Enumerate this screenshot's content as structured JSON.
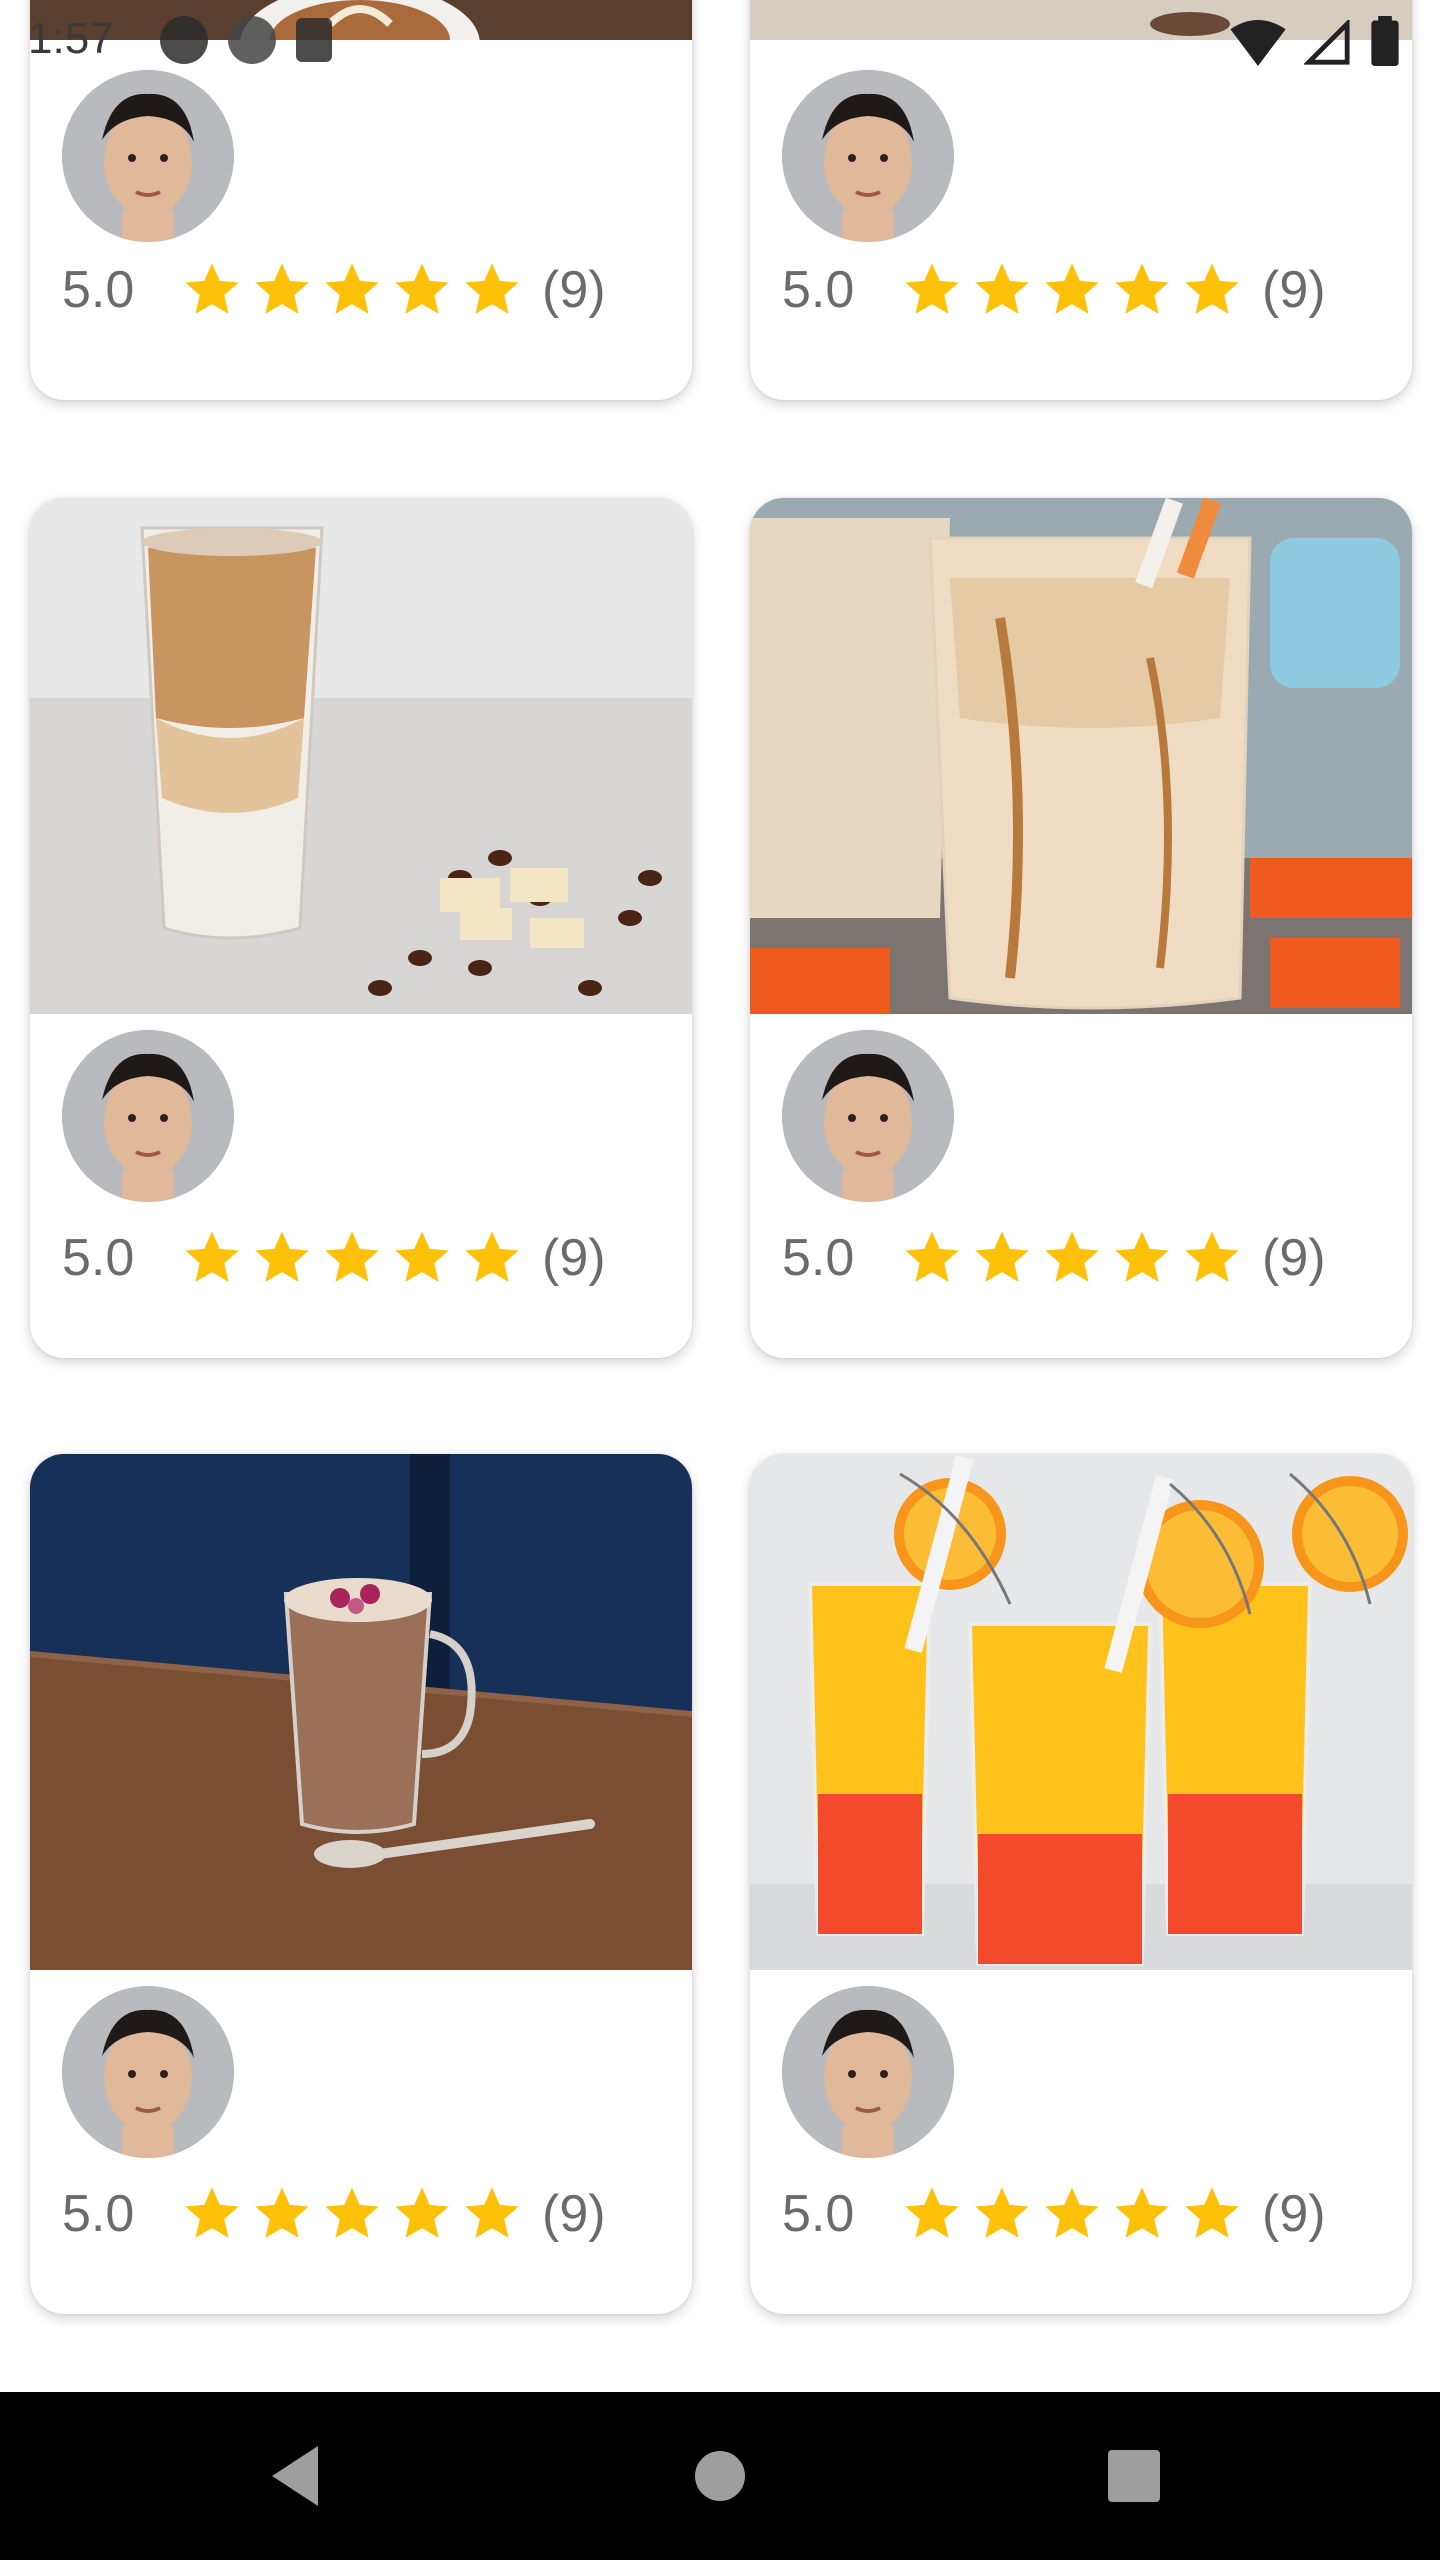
{
  "status_bar": {
    "time": "1:57"
  },
  "cards": [
    {
      "image": "latte-art-coffee",
      "rating": "5.0",
      "count": "(9)",
      "stars": 5
    },
    {
      "image": "chocolate-drink",
      "rating": "5.0",
      "count": "(9)",
      "stars": 5
    },
    {
      "image": "iced-latte-glass",
      "rating": "5.0",
      "count": "(9)",
      "stars": 5
    },
    {
      "image": "iced-caramel-jar",
      "rating": "5.0",
      "count": "(9)",
      "stars": 5
    },
    {
      "image": "hot-chocolate-mug",
      "rating": "5.0",
      "count": "(9)",
      "stars": 5
    },
    {
      "image": "orange-sunrise-drinks",
      "rating": "5.0",
      "count": "(9)",
      "stars": 5
    }
  ],
  "colors": {
    "star": "#FFC107",
    "text_muted": "#6b6b6b",
    "avatar_bg": "#b9babd"
  },
  "nav_bar": {
    "back": "back-icon",
    "home": "home-icon",
    "recents": "recents-icon"
  }
}
